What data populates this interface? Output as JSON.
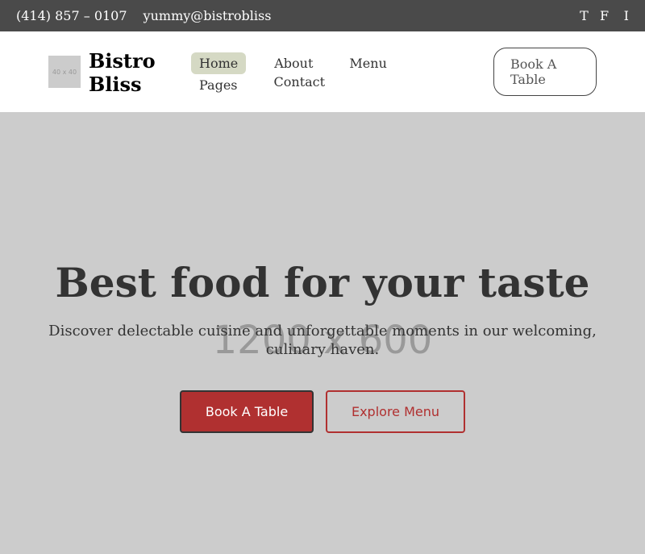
{
  "topbar": {
    "phone": "(414) 857 – 0107",
    "email": "yummy@bistrobliss",
    "social": [
      "T",
      "F",
      "I"
    ]
  },
  "header": {
    "logo_placeholder": "40 x 40",
    "brand": "Bistro Bliss",
    "nav": [
      {
        "label": "Home",
        "active": true
      },
      {
        "label": "About",
        "active": false
      },
      {
        "label": "Menu",
        "active": false
      },
      {
        "label": "Pages",
        "active": false
      },
      {
        "label": "Contact",
        "active": false
      }
    ],
    "book_button": "Book A Table"
  },
  "hero": {
    "image_placeholder": "1200 x 600",
    "title": "Best food for your taste",
    "subtitle": "Discover delectable cuisine and unforgettable moments in our welcoming, culinary haven.",
    "primary_button": "Book A Table",
    "secondary_button": "Explore Menu"
  },
  "colors": {
    "topbar_bg": "#4a4a4a",
    "accent": "#b03030",
    "active_nav_bg": "#d5d9c4"
  }
}
